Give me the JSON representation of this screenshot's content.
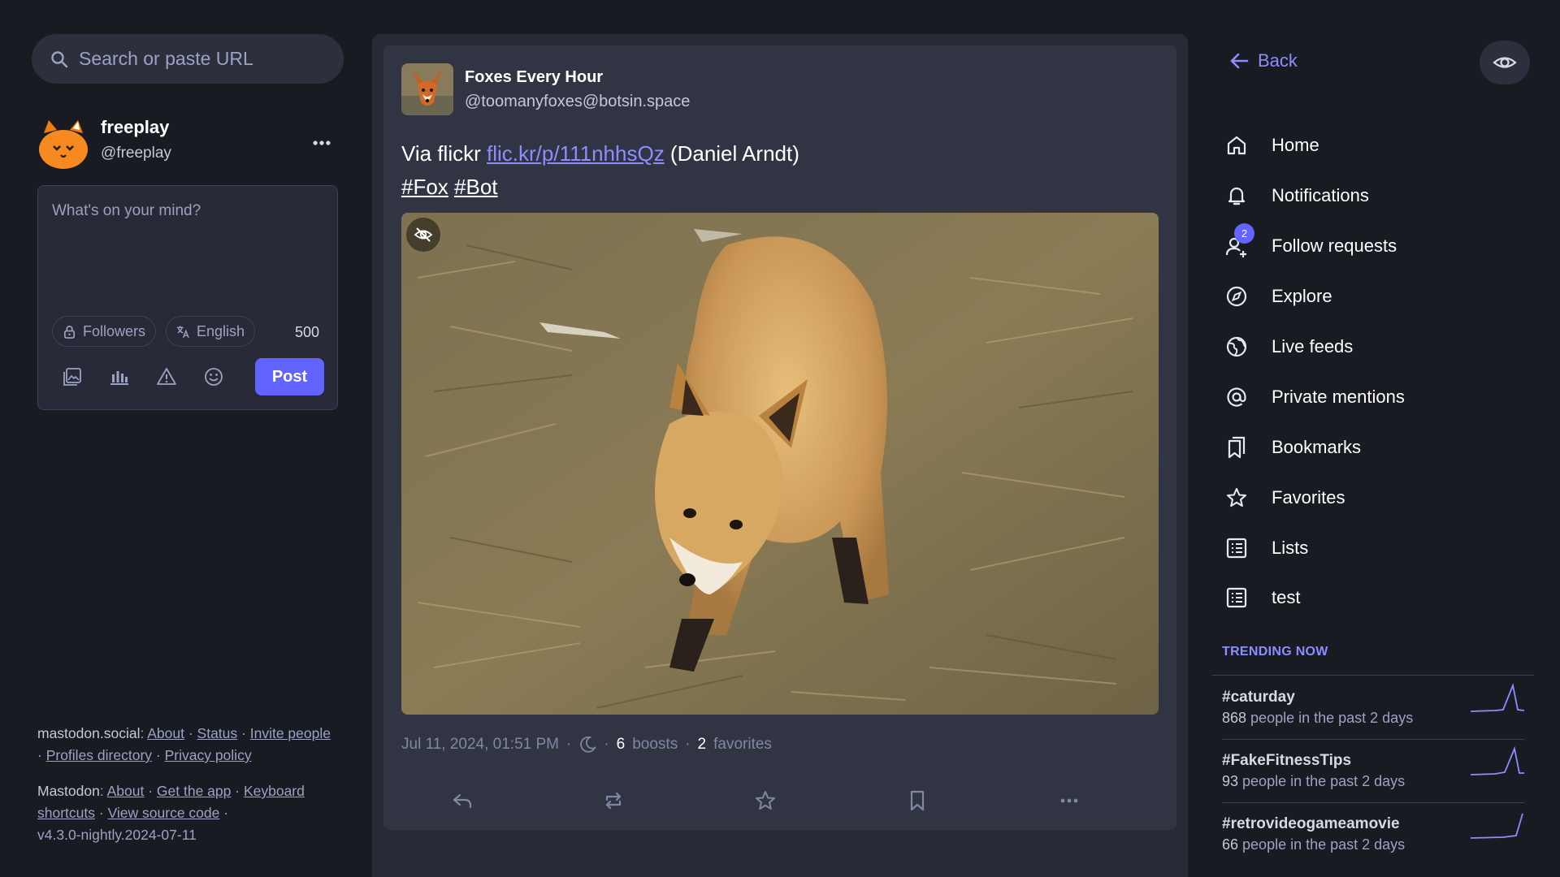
{
  "search": {
    "placeholder": "Search or paste URL"
  },
  "account": {
    "display_name": "freeplay",
    "handle": "@freeplay"
  },
  "composer": {
    "placeholder": "What's on your mind?",
    "visibility": "Followers",
    "language": "English",
    "char_count": "500",
    "post_label": "Post"
  },
  "footer": {
    "server": "mastodon.social",
    "about": "About",
    "status": "Status",
    "invite": "Invite people",
    "profiles_directory": "Profiles directory",
    "privacy_policy": "Privacy policy",
    "mastodon": "Mastodon",
    "about2": "About",
    "get_the_app": "Get the app",
    "keyboard_shortcuts": "Keyboard shortcuts",
    "view_source": "View source code",
    "version": "v4.3.0-nightly.2024-07-11"
  },
  "status": {
    "author": "Foxes Every Hour",
    "acct": "@toomanyfoxes@botsin.space",
    "text_prefix": "Via flickr ",
    "link": "flic.kr/p/111nhhsQz",
    "text_suffix": " (Daniel Arndt)",
    "hashtags": [
      "#Fox",
      "#Bot"
    ],
    "timestamp": "Jul 11, 2024, 01:51 PM",
    "boosts_count": "6",
    "boosts_label": "boosts",
    "favorites_count": "2",
    "favorites_label": "favorites"
  },
  "nav": {
    "back": "Back",
    "items": [
      {
        "label": "Home",
        "icon": "home-icon"
      },
      {
        "label": "Notifications",
        "icon": "bell-icon"
      },
      {
        "label": "Follow requests",
        "icon": "person-add-icon",
        "badge": "2"
      },
      {
        "label": "Explore",
        "icon": "compass-icon"
      },
      {
        "label": "Live feeds",
        "icon": "globe-icon"
      },
      {
        "label": "Private mentions",
        "icon": "at-icon"
      },
      {
        "label": "Bookmarks",
        "icon": "bookmarks-icon"
      },
      {
        "label": "Favorites",
        "icon": "star-icon"
      },
      {
        "label": "Lists",
        "icon": "list-icon"
      },
      {
        "label": "test",
        "icon": "list-icon"
      }
    ]
  },
  "trending": {
    "title": "TRENDING NOW",
    "items": [
      {
        "tag": "#caturday",
        "count": "868",
        "suffix": " people in the past 2 days"
      },
      {
        "tag": "#FakeFitnessTips",
        "count": "93",
        "suffix": " people in the past 2 days"
      },
      {
        "tag": "#retrovideogameamovie",
        "count": "66",
        "suffix": " people in the past 2 days"
      }
    ]
  },
  "colors": {
    "accent": "#6364ff",
    "link": "#8c8dff",
    "background": "#191b22",
    "card": "#313543"
  }
}
